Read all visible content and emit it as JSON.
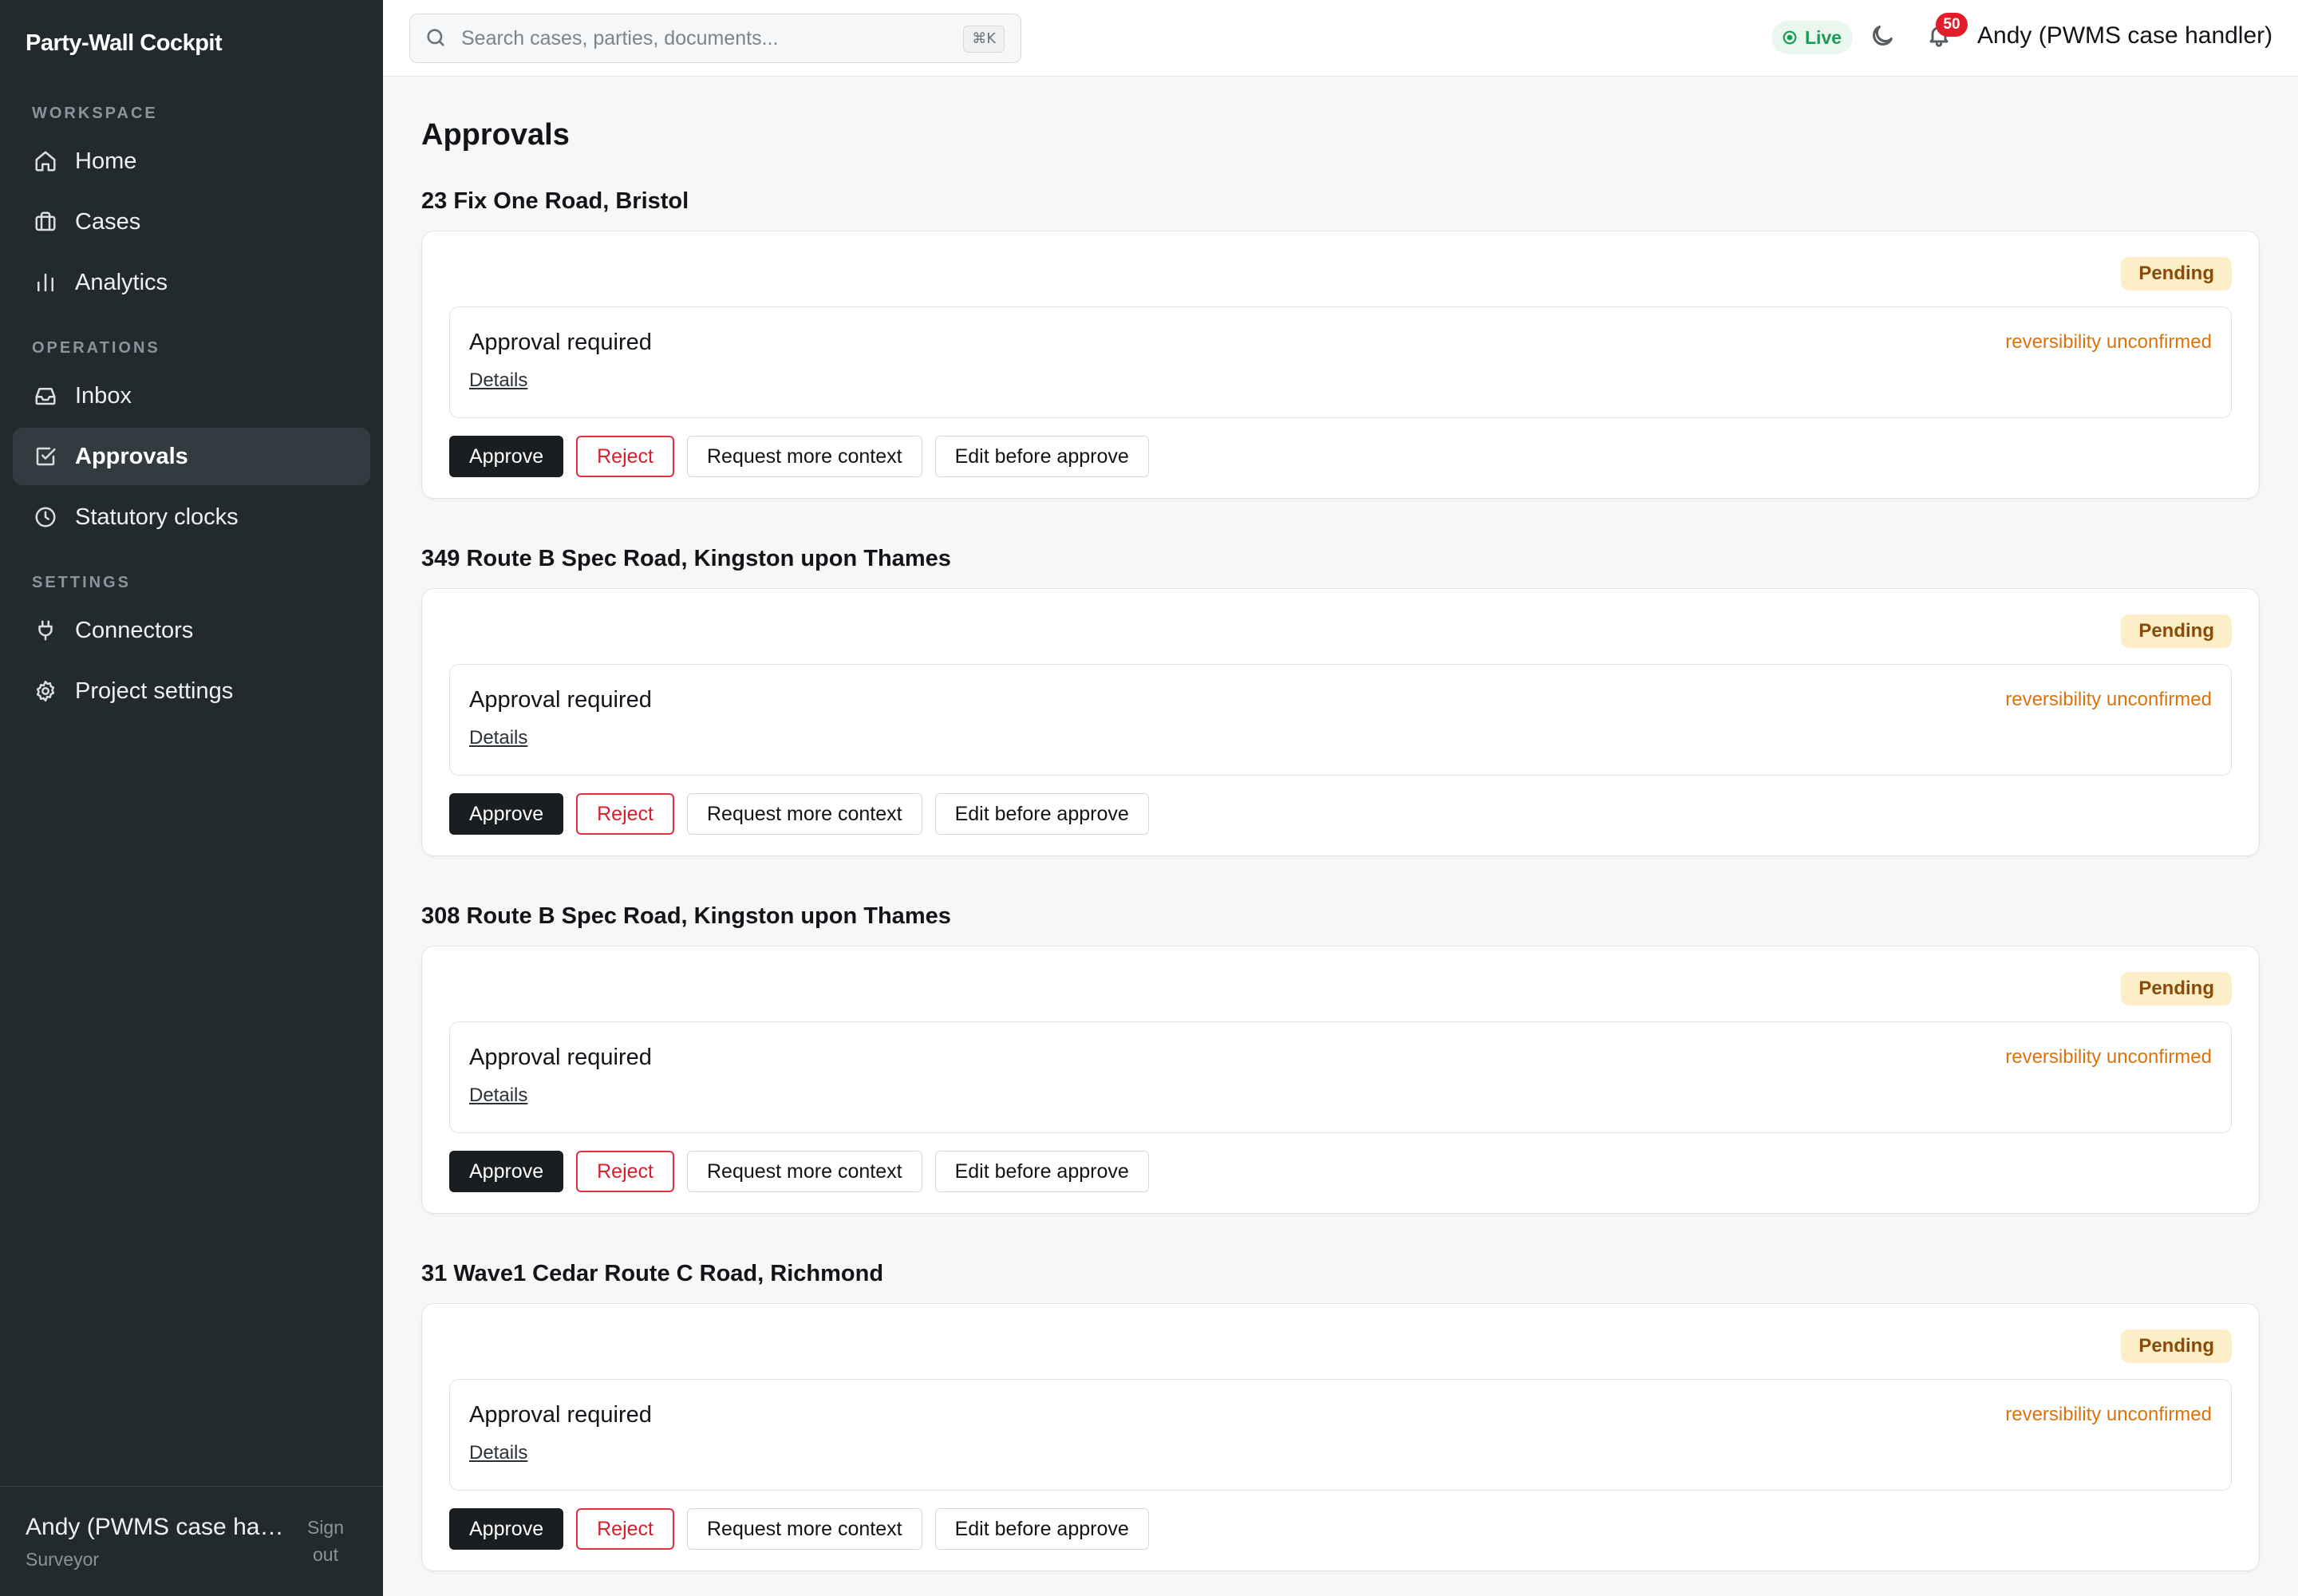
{
  "app": {
    "brand": "Party-Wall Cockpit"
  },
  "sidebar": {
    "sections": [
      {
        "label": "WORKSPACE"
      },
      {
        "label": "OPERATIONS"
      },
      {
        "label": "SETTINGS"
      }
    ],
    "items": [
      {
        "label": "Home",
        "icon": "home-icon"
      },
      {
        "label": "Cases",
        "icon": "briefcase-icon"
      },
      {
        "label": "Analytics",
        "icon": "bar-chart-icon"
      },
      {
        "label": "Inbox",
        "icon": "inbox-icon"
      },
      {
        "label": "Approvals",
        "icon": "check-square-icon",
        "active": true
      },
      {
        "label": "Statutory clocks",
        "icon": "clock-icon"
      },
      {
        "label": "Connectors",
        "icon": "plug-icon"
      },
      {
        "label": "Project settings",
        "icon": "gear-icon"
      }
    ],
    "footer": {
      "name": "Andy (PWMS case handler)",
      "role": "Surveyor",
      "signout": "Sign out"
    }
  },
  "topbar": {
    "search_placeholder": "Search cases, parties, documents...",
    "search_value": "",
    "shortcut": "⌘K",
    "live_label": "Live",
    "notifications_count": "50",
    "user_name": "Andy (PWMS case handler)"
  },
  "main": {
    "title": "Approvals",
    "cases": [
      {
        "address": "23 Fix One Road, Bristol",
        "status": "Pending",
        "request_title": "Approval required",
        "details_label": "Details",
        "warning": "reversibility unconfirmed",
        "actions": {
          "approve": "Approve",
          "reject": "Reject",
          "context": "Request more context",
          "edit": "Edit before approve"
        }
      },
      {
        "address": "349 Route B Spec Road, Kingston upon Thames",
        "status": "Pending",
        "request_title": "Approval required",
        "details_label": "Details",
        "warning": "reversibility unconfirmed",
        "actions": {
          "approve": "Approve",
          "reject": "Reject",
          "context": "Request more context",
          "edit": "Edit before approve"
        }
      },
      {
        "address": "308 Route B Spec Road, Kingston upon Thames",
        "status": "Pending",
        "request_title": "Approval required",
        "details_label": "Details",
        "warning": "reversibility unconfirmed",
        "actions": {
          "approve": "Approve",
          "reject": "Reject",
          "context": "Request more context",
          "edit": "Edit before approve"
        }
      },
      {
        "address": "31 Wave1 Cedar Route C Road, Richmond",
        "status": "Pending",
        "request_title": "Approval required",
        "details_label": "Details",
        "warning": "reversibility unconfirmed",
        "actions": {
          "approve": "Approve",
          "reject": "Reject",
          "context": "Request more context",
          "edit": "Edit before approve"
        }
      }
    ]
  },
  "colors": {
    "sidebar_bg": "#232a2e",
    "live_green": "#1d9a54",
    "pending_bg": "#fcefc7",
    "warning_orange": "#d9730d",
    "reject_red": "#d71f2b",
    "badge_red": "#e11d2a"
  }
}
